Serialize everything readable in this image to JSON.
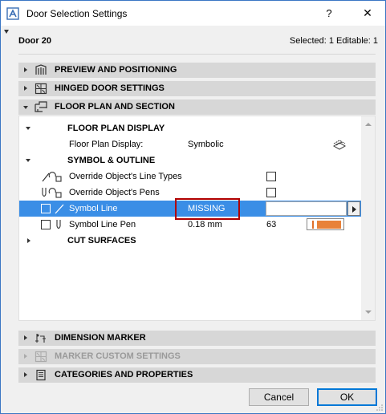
{
  "window": {
    "title": "Door Selection Settings",
    "help_label": "?",
    "close_label": "✕",
    "accent": "#3b76c4"
  },
  "header": {
    "element_name": "Door 20",
    "selection_info": "Selected: 1 Editable: 1"
  },
  "sections": {
    "preview": {
      "label": "PREVIEW AND POSITIONING",
      "icon": "preview-icon"
    },
    "hinged": {
      "label": "HINGED DOOR SETTINGS",
      "icon": "hinged-door-icon"
    },
    "floorplan": {
      "label": "FLOOR PLAN AND SECTION",
      "icon": "floor-plan-icon"
    },
    "dimension": {
      "label": "DIMENSION MARKER",
      "icon": "dimension-marker-icon"
    },
    "marker": {
      "label": "MARKER CUSTOM SETTINGS",
      "icon": "marker-icon",
      "disabled": true
    },
    "categories": {
      "label": "CATEGORIES AND PROPERTIES",
      "icon": "categories-icon"
    }
  },
  "panel": {
    "fp_display_group": "FLOOR PLAN DISPLAY",
    "fp_display_label": "Floor Plan Display:",
    "fp_display_value": "Symbolic",
    "symbol_group": "SYMBOL & OUTLINE",
    "override_line_types": "Override Object's Line Types",
    "override_pens": "Override Object's Pens",
    "symbol_line_label": "Symbol Line",
    "symbol_line_value": "MISSING",
    "symbol_line_pen_label": "Symbol Line Pen",
    "symbol_line_pen_value": "0.18 mm",
    "symbol_line_pen_number": "63",
    "pen_color": "#e8823a",
    "cut_surfaces_group": "CUT SURFACES",
    "selected_row_color": "#3a8ee6"
  },
  "buttons": {
    "cancel": "Cancel",
    "ok": "OK"
  }
}
